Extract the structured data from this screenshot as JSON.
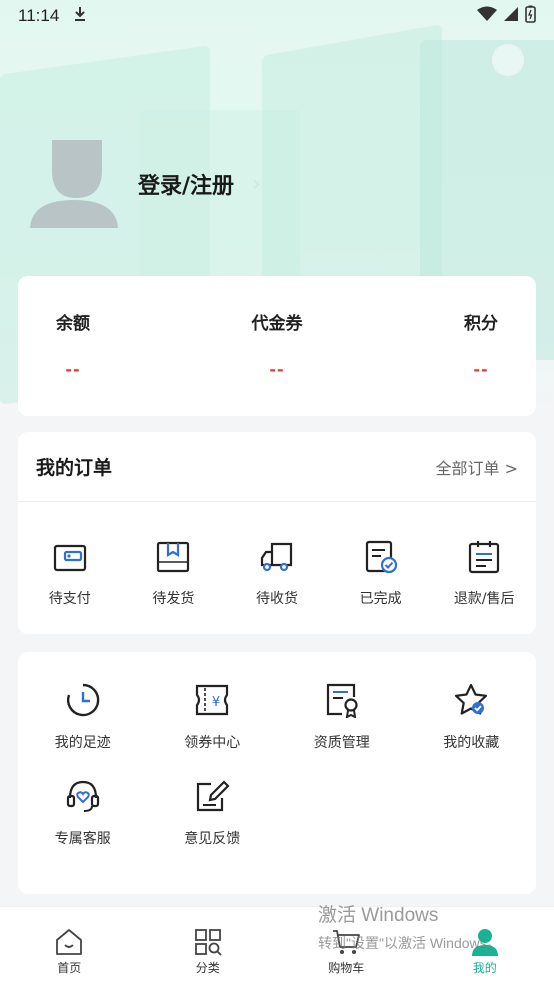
{
  "status_bar": {
    "time": "11:14"
  },
  "profile": {
    "login_label": "登录/注册"
  },
  "balance": {
    "items": [
      {
        "label": "余额",
        "value": "--"
      },
      {
        "label": "代金券",
        "value": "--"
      },
      {
        "label": "积分",
        "value": "--"
      }
    ]
  },
  "orders": {
    "title": "我的订单",
    "all_label": "全部订单 >",
    "items": [
      {
        "label": "待支付",
        "icon": "wallet-icon"
      },
      {
        "label": "待发货",
        "icon": "box-icon"
      },
      {
        "label": "待收货",
        "icon": "truck-icon"
      },
      {
        "label": "已完成",
        "icon": "completed-doc-icon"
      },
      {
        "label": "退款/售后",
        "icon": "refund-clipboard-icon"
      }
    ]
  },
  "services": {
    "items": [
      {
        "label": "我的足迹",
        "icon": "clock-icon"
      },
      {
        "label": "领券中心",
        "icon": "coupon-icon"
      },
      {
        "label": "资质管理",
        "icon": "certificate-icon"
      },
      {
        "label": "我的收藏",
        "icon": "star-icon"
      },
      {
        "label": "专属客服",
        "icon": "headset-icon"
      },
      {
        "label": "意见反馈",
        "icon": "feedback-edit-icon"
      }
    ]
  },
  "watermark": {
    "line1": "激活 Windows",
    "line2": "转到\"设置\"以激活 Windows。"
  },
  "tabbar": {
    "items": [
      {
        "label": "首页",
        "icon": "home-icon",
        "active": false
      },
      {
        "label": "分类",
        "icon": "category-icon",
        "active": false
      },
      {
        "label": "购物车",
        "icon": "cart-icon",
        "active": false
      },
      {
        "label": "我的",
        "icon": "user-icon",
        "active": true
      }
    ]
  },
  "colors": {
    "accent": "#19b394",
    "price_red": "#e53935",
    "icon_blue": "#2f6fd6"
  }
}
